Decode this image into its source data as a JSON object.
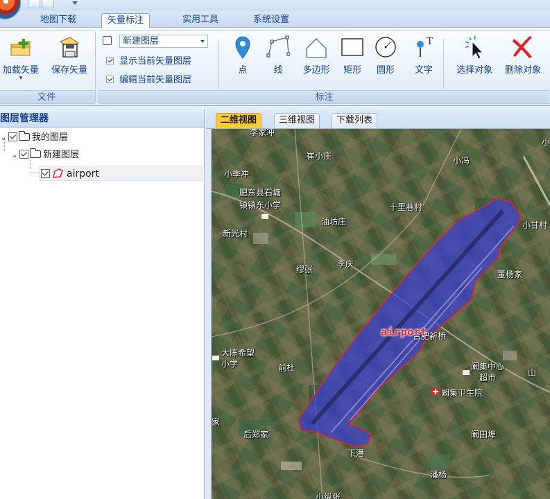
{
  "menu": {
    "tabs": [
      {
        "label": "地图下载",
        "active": false
      },
      {
        "label": "矢量标注",
        "active": true
      },
      {
        "label": "实用工具",
        "active": false
      },
      {
        "label": "系统设置",
        "active": false
      }
    ]
  },
  "ribbon": {
    "file_group": {
      "label": "文件",
      "load_vector": "加载矢量",
      "save_vector": "保存矢量"
    },
    "layer_group": {
      "layer_select_value": "新建图层",
      "show_current": "显示当前矢量图层",
      "edit_current": "编辑当前矢量图层",
      "show_current_checked": true,
      "edit_current_checked": true
    },
    "annotate_group": {
      "label": "标注",
      "point": "点",
      "line": "线",
      "polygon": "多边形",
      "rectangle": "矩形",
      "circle": "圆形",
      "text": "文字",
      "select_object": "选择对象",
      "delete_object": "删除对象"
    }
  },
  "layer_panel": {
    "title": "图层管理器",
    "tree": {
      "root": {
        "label": "我的图层",
        "checked": true
      },
      "child": {
        "label": "新建图层",
        "checked": true
      },
      "leaf": {
        "label": "airport",
        "checked": true
      }
    }
  },
  "map_view": {
    "tabs": [
      {
        "label": "二维视图",
        "active": true
      },
      {
        "label": "三维视图",
        "active": false
      },
      {
        "label": "下载列表",
        "active": false
      }
    ],
    "feature_label": "airport",
    "places": {
      "p1": "李家冲",
      "p2": "崔小庄",
      "p3": "小冯",
      "p4": "小季冲",
      "p5": "肥东县石塘",
      "p6": "镇镇东小学",
      "p7": "十里巷村",
      "p8": "油坊庄",
      "p9": "新光村",
      "p10": "小甘村",
      "p11": "缪张",
      "p12": "李庆",
      "p13": "董杨家",
      "p14": "大陈希望",
      "p15": "小学",
      "p16": "前杜",
      "p17": "合肥新桥",
      "p18": "阚集中心",
      "p19": "超市",
      "p20": "阚集卫生院",
      "p21": "家",
      "p22": "后郑家",
      "p23": "阚田埠",
      "p24": "下潘",
      "p25": "潘杨",
      "p26": "山",
      "p27": "小纵张",
      "p28": "小"
    }
  },
  "colors": {
    "polygon_fill": "#3a3fd0",
    "polygon_stroke": "#e8222a",
    "ribbon_text": "#15428b",
    "active_view_tab": "#ffcc33"
  }
}
